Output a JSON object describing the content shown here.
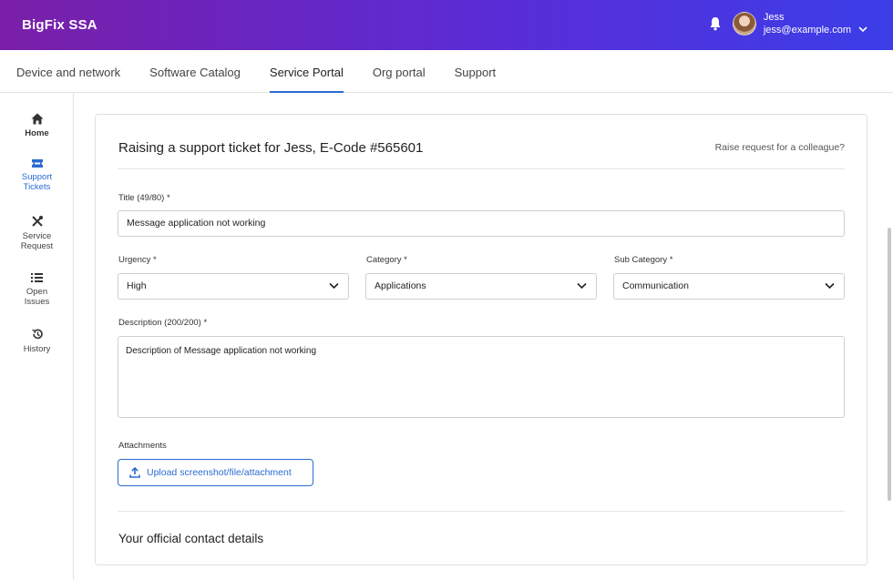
{
  "app": {
    "title": "BigFix SSA"
  },
  "user": {
    "name": "Jess",
    "email": "jess@example.com"
  },
  "tabs": [
    {
      "label": "Device and network"
    },
    {
      "label": "Software Catalog"
    },
    {
      "label": "Service Portal"
    },
    {
      "label": "Org portal"
    },
    {
      "label": "Support"
    }
  ],
  "sidebar": {
    "home": "Home",
    "support": [
      "Support",
      "Tickets"
    ],
    "service": [
      "Service",
      "Request"
    ],
    "open": [
      "Open",
      "Issues"
    ],
    "history": "History"
  },
  "form": {
    "heading": "Raising a support ticket for Jess, E-Code #565601",
    "colleague_link": "Raise request for a colleague?",
    "title_label": "Title (49/80) *",
    "title_value": "Message application not working",
    "urgency_label": "Urgency *",
    "urgency_value": "High",
    "category_label": "Category *",
    "category_value": "Applications",
    "subcategory_label": "Sub Category *",
    "subcategory_value": "Communication",
    "description_label": "Description (200/200) *",
    "description_value": "Description of Message application not working",
    "attachments_label": "Attachments",
    "upload_label": "Upload screenshot/file/attachment",
    "contact_heading": "Your official contact details"
  },
  "colors": {
    "accent": "#2a6bd1",
    "header_start": "#7a1fa8",
    "header_end": "#3b3ee8"
  }
}
